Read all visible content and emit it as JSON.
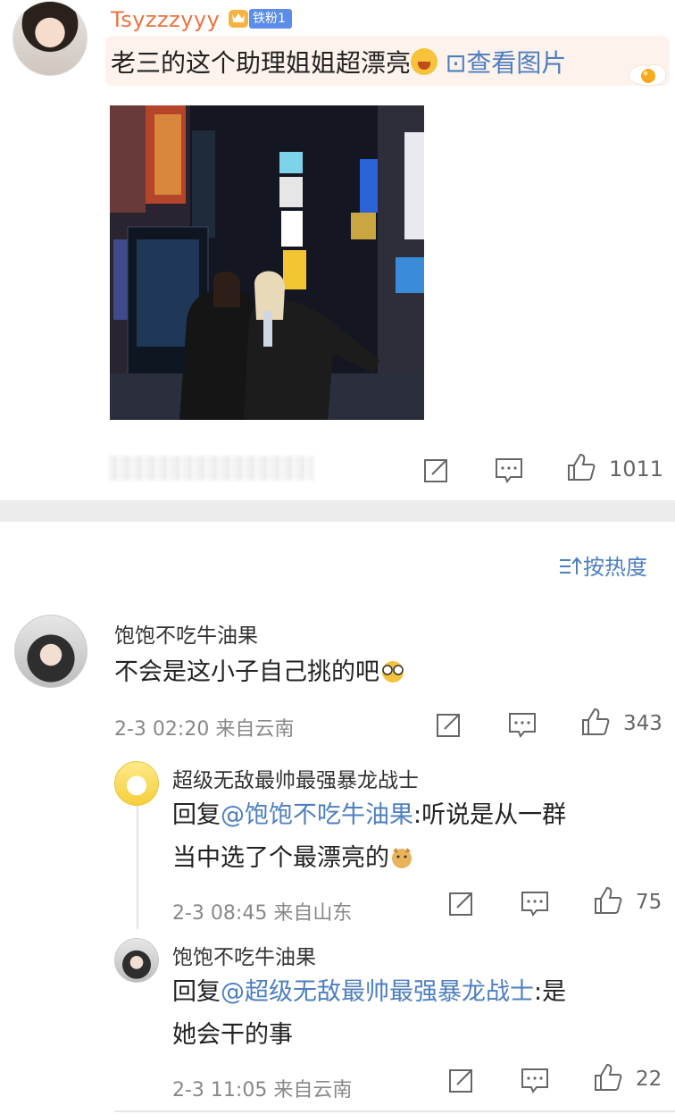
{
  "post": {
    "username": "Tsyzzzyyy",
    "badge": "铁粉1",
    "text": "老三的这个助理姐姐超漂亮",
    "view_pic": "⊡查看图片",
    "like_count": "1011"
  },
  "sort_label": "按热度",
  "comments": [
    {
      "username": "饱饱不吃牛油果",
      "text": "不会是这小子自己挑的吧",
      "meta": "2-3 02:20  来自云南",
      "likes": "343"
    }
  ],
  "replies": [
    {
      "username": "超级无敌最帅最强暴龙战士",
      "prefix": "回复",
      "mention": "@饱饱不吃牛油果",
      "line1": ":听说是从一群",
      "line2": "当中选了个最漂亮的",
      "meta": "2-3 08:45  来自山东",
      "likes": "75"
    },
    {
      "username": "饱饱不吃牛油果",
      "prefix": "回复",
      "mention": "@超级无敌最帅最强暴龙战士",
      "line1": ":是",
      "line2": "她会干的事",
      "meta": "2-3 11:05  来自云南",
      "likes": "22"
    }
  ],
  "colors": {
    "username_orange": "#eb7340",
    "link_blue": "#4e7fbf",
    "badge_blue": "#5b8de9",
    "bubble": "#fdf2ec"
  },
  "icons": [
    "share-icon",
    "comment-icon",
    "like-icon",
    "sort-icon",
    "crown-icon",
    "egg-icon"
  ]
}
